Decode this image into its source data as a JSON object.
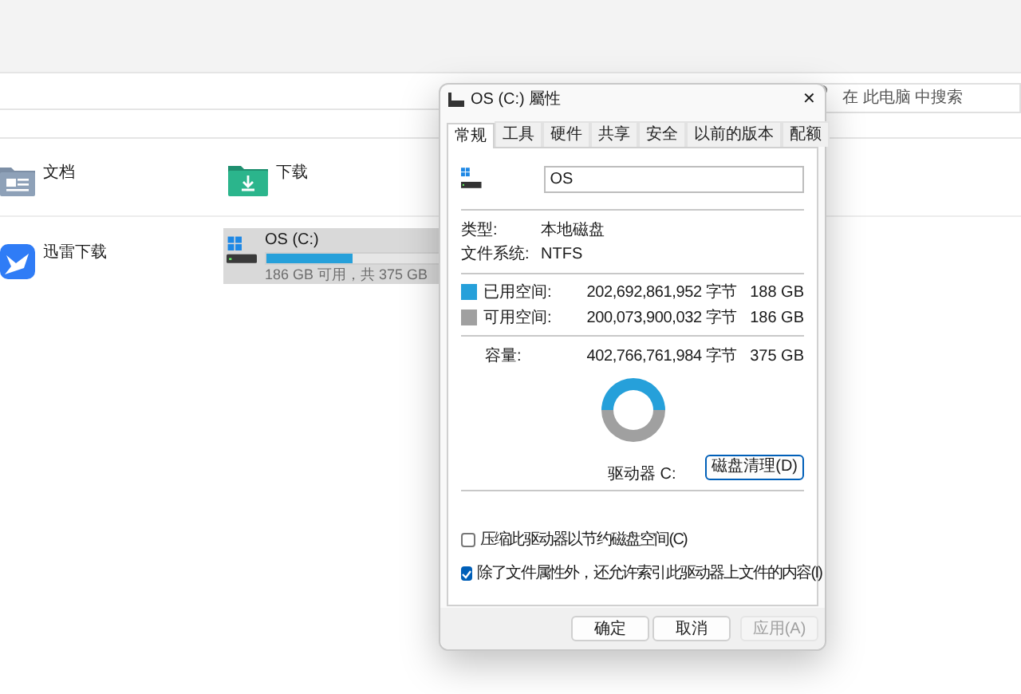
{
  "explorer": {
    "search": {
      "placeholder": "在 此电脑 中搜索"
    },
    "items": [
      {
        "kind": "documents",
        "label": "文档"
      },
      {
        "kind": "downloads",
        "label": "下载"
      },
      {
        "kind": "app",
        "label": "迅雷下载"
      }
    ],
    "drive": {
      "label": "OS (C:)",
      "level": 0.503,
      "detail": "186 GB 可用，共 375 GB",
      "selected": true
    }
  },
  "dialog": {
    "title": "OS (C:) 屬性",
    "close": "✕",
    "tabs": [
      {
        "label": "常规",
        "selected": true
      },
      {
        "label": "工具",
        "selected": false
      },
      {
        "label": "硬件",
        "selected": false
      },
      {
        "label": "共享",
        "selected": false
      },
      {
        "label": "安全",
        "selected": false
      },
      {
        "label": "以前的版本",
        "selected": false
      },
      {
        "label": "配额",
        "selected": false
      }
    ],
    "name_field": {
      "value": "OS"
    },
    "info": [
      {
        "label": "类型:",
        "value": "本地磁盘"
      },
      {
        "label": "文件系统:",
        "value": "NTFS"
      }
    ],
    "space": [
      {
        "label": "已用空间:",
        "bytes": "202,692,861,952 字节",
        "size": "188 GB",
        "color": "#26a0da"
      },
      {
        "label": "可用空间:",
        "bytes": "200,073,900,032 字节",
        "size": "186 GB",
        "color": "#a0a0a0"
      }
    ],
    "capacity": {
      "label": "容量:",
      "bytes": "402,766,761,984 字节",
      "size": "375 GB"
    },
    "drive_label": "驱动器 C:",
    "cleanup_button": "磁盘清理(D)",
    "options": [
      {
        "label": "压缩此驱动器以节约磁盘空间(C)",
        "checked": false
      },
      {
        "label": "除了文件属性外，还允许索引此驱动器上文件的内容(I)",
        "checked": true
      }
    ],
    "buttons": [
      {
        "label": "确定",
        "disabled": false
      },
      {
        "label": "取消",
        "disabled": false
      },
      {
        "label": "应用(A)",
        "disabled": true
      }
    ]
  }
}
